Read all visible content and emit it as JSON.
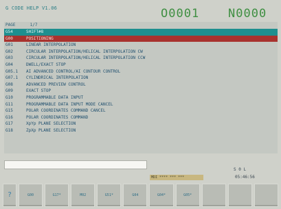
{
  "header": {
    "app_title": "G CODE HELP V1.06",
    "program_number": "O0001",
    "sequence_number": "N0000"
  },
  "list": {
    "col_code": "PAGE",
    "col_desc": "1/7",
    "rows": [
      {
        "code": "G54",
        "desc": "SHIFT#8",
        "state": "teal"
      },
      {
        "code": "G00",
        "desc": "POSITIONING",
        "state": "red"
      },
      {
        "code": "G01",
        "desc": "LINEAR INTERPOLATION",
        "state": ""
      },
      {
        "code": "G02",
        "desc": "CIRCULAR INTERPOLATION/HELICAL INTERPOLATION CW",
        "state": ""
      },
      {
        "code": "G03",
        "desc": "CIRCULAR INTERPOLATION/HELICAL INTERPOLATION CCW",
        "state": ""
      },
      {
        "code": "G04",
        "desc": "DWELL/EXACT STOP",
        "state": ""
      },
      {
        "code": "G05.1",
        "desc": "AI ADVANCED CONTROL/AI CONTOUR CONTROL",
        "state": ""
      },
      {
        "code": "G07.1",
        "desc": "CYLINDRICAL INTERPOLATION",
        "state": ""
      },
      {
        "code": "G08",
        "desc": "ADVANCED PREVIEW CONTROL",
        "state": ""
      },
      {
        "code": "G09",
        "desc": "EXACT STOP",
        "state": ""
      },
      {
        "code": "G10",
        "desc": "PROGRAMMABLE DATA INPUT",
        "state": ""
      },
      {
        "code": "G11",
        "desc": "PROGRAMMABLE DATA INPUT MODE CANCEL",
        "state": ""
      },
      {
        "code": "G15",
        "desc": "POLAR COORDINATES COMMAND CANCEL",
        "state": ""
      },
      {
        "code": "G16",
        "desc": "POLAR COORDINATES COMMAND",
        "state": ""
      },
      {
        "code": "G17",
        "desc": "XpYp PLANE SELECTION",
        "state": ""
      },
      {
        "code": "G18",
        "desc": "ZpXp PLANE SELECTION",
        "state": ""
      }
    ]
  },
  "input_line": {
    "value": ""
  },
  "status": {
    "letters": "S    0 L",
    "mode_text": "MDI **** *** ***",
    "clock": "05:46:56"
  },
  "softkeys": [
    {
      "label": "?",
      "kind": "arrow"
    },
    {
      "label": "G00",
      "kind": ""
    },
    {
      "label": "G17*",
      "kind": ""
    },
    {
      "label": "M02",
      "kind": ""
    },
    {
      "label": "G51*",
      "kind": ""
    },
    {
      "label": "G04",
      "kind": ""
    },
    {
      "label": "G04*",
      "kind": ""
    },
    {
      "label": "G05*",
      "kind": ""
    },
    {
      "label": "",
      "kind": ""
    },
    {
      "label": "",
      "kind": ""
    },
    {
      "label": "",
      "kind": ""
    }
  ]
}
